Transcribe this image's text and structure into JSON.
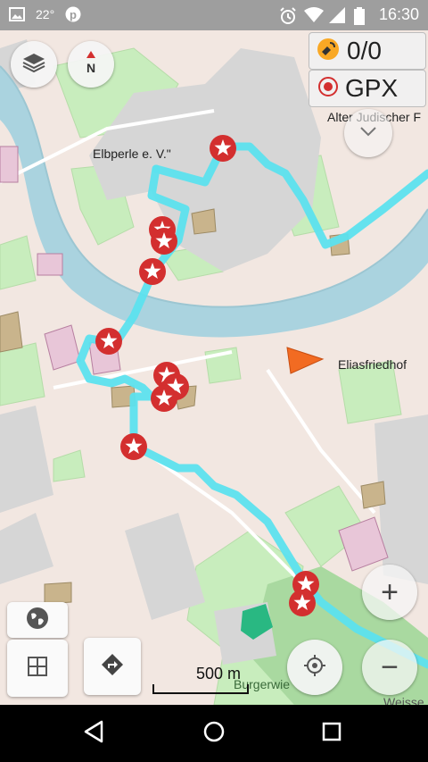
{
  "status_bar": {
    "temperature": "22°",
    "time": "16:30",
    "icons": [
      "image-icon",
      "pinterest-icon",
      "alarm-icon",
      "wifi-icon",
      "signal-icon",
      "battery-icon"
    ]
  },
  "map": {
    "labels": {
      "elbperle": "Elbperle e. V.\"",
      "alter_judischer": "Alter Judischer F",
      "eliasfriedhof": "Eliasfriedhof",
      "burgerwiese": "Burgerwie",
      "weisse": "Weisse"
    },
    "track_color": "#5ce1ee",
    "river_color": "#aad3df",
    "marker_color": "#d32f2f",
    "markers_count": 11
  },
  "widgets": {
    "waypoints": {
      "value": "0/0",
      "icon": "satellite-icon"
    },
    "gpx": {
      "label": "GPX",
      "icon": "record-icon"
    }
  },
  "controls": {
    "layers": "layers-icon",
    "compass_letter": "N",
    "zoom_in": "+",
    "zoom_out": "−",
    "expand": "chevron-down-icon"
  },
  "scale_bar": {
    "label": "500 m"
  },
  "nav_bar": {
    "icons": [
      "back-icon",
      "home-icon",
      "recents-icon"
    ]
  }
}
